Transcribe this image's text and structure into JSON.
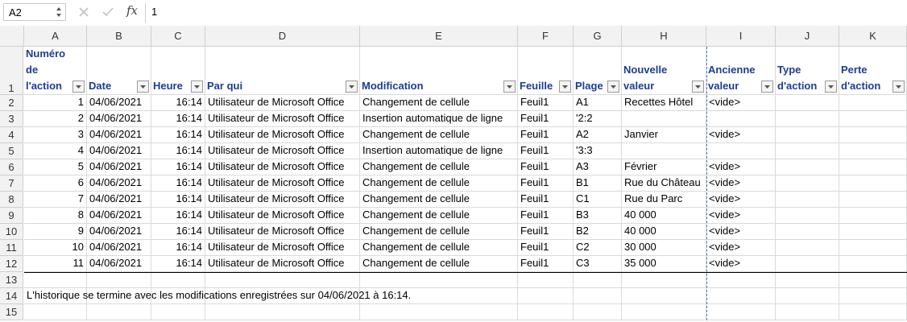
{
  "formula_bar": {
    "name_box": "A2",
    "formula": "1",
    "icons": [
      "cancel-icon",
      "confirm-icon",
      "fx-icon"
    ]
  },
  "columns": [
    "A",
    "B",
    "C",
    "D",
    "E",
    "F",
    "G",
    "H",
    "I",
    "J",
    "K"
  ],
  "row_numbers": [
    "1",
    "2",
    "3",
    "4",
    "5",
    "6",
    "7",
    "8",
    "9",
    "10",
    "11",
    "12",
    "13",
    "14",
    "15"
  ],
  "headers": {
    "A": "Numéro de l'action",
    "B": "Date",
    "C": "Heure",
    "D": "Par qui",
    "E": "Modification",
    "F": "Feuille",
    "G": "Plage",
    "H": "Nouvelle valeur",
    "I": "Ancienne valeur",
    "J": "Type d'action",
    "K": "Perte d'action"
  },
  "rows": [
    {
      "num": "1",
      "date": "04/06/2021",
      "time": "16:14",
      "who": "Utilisateur de Microsoft Office",
      "mod": "Changement de cellule",
      "sheet": "Feuil1",
      "range": "A1",
      "new": "Recettes Hôtel",
      "old": "<vide>"
    },
    {
      "num": "2",
      "date": "04/06/2021",
      "time": "16:14",
      "who": "Utilisateur de Microsoft Office",
      "mod": "Insertion automatique de ligne",
      "sheet": "Feuil1",
      "range": "'2:2",
      "new": "",
      "old": ""
    },
    {
      "num": "3",
      "date": "04/06/2021",
      "time": "16:14",
      "who": "Utilisateur de Microsoft Office",
      "mod": "Changement de cellule",
      "sheet": "Feuil1",
      "range": "A2",
      "new": "Janvier",
      "old": "<vide>"
    },
    {
      "num": "4",
      "date": "04/06/2021",
      "time": "16:14",
      "who": "Utilisateur de Microsoft Office",
      "mod": "Insertion automatique de ligne",
      "sheet": "Feuil1",
      "range": "'3:3",
      "new": "",
      "old": ""
    },
    {
      "num": "5",
      "date": "04/06/2021",
      "time": "16:14",
      "who": "Utilisateur de Microsoft Office",
      "mod": "Changement de cellule",
      "sheet": "Feuil1",
      "range": "A3",
      "new": "Février",
      "old": "<vide>"
    },
    {
      "num": "6",
      "date": "04/06/2021",
      "time": "16:14",
      "who": "Utilisateur de Microsoft Office",
      "mod": "Changement de cellule",
      "sheet": "Feuil1",
      "range": "B1",
      "new": "Rue du Château",
      "old": "<vide>"
    },
    {
      "num": "7",
      "date": "04/06/2021",
      "time": "16:14",
      "who": "Utilisateur de Microsoft Office",
      "mod": "Changement de cellule",
      "sheet": "Feuil1",
      "range": "C1",
      "new": "Rue du Parc",
      "old": "<vide>"
    },
    {
      "num": "8",
      "date": "04/06/2021",
      "time": "16:14",
      "who": "Utilisateur de Microsoft Office",
      "mod": "Changement de cellule",
      "sheet": "Feuil1",
      "range": "B3",
      "new": "40 000",
      "old": "<vide>"
    },
    {
      "num": "9",
      "date": "04/06/2021",
      "time": "16:14",
      "who": "Utilisateur de Microsoft Office",
      "mod": "Changement de cellule",
      "sheet": "Feuil1",
      "range": "B2",
      "new": "40 000",
      "old": "<vide>"
    },
    {
      "num": "10",
      "date": "04/06/2021",
      "time": "16:14",
      "who": "Utilisateur de Microsoft Office",
      "mod": "Changement de cellule",
      "sheet": "Feuil1",
      "range": "C2",
      "new": "30 000",
      "old": "<vide>"
    },
    {
      "num": "11",
      "date": "04/06/2021",
      "time": "16:14",
      "who": "Utilisateur de Microsoft Office",
      "mod": "Changement de cellule",
      "sheet": "Feuil1",
      "range": "C3",
      "new": "35 000",
      "old": "<vide>"
    }
  ],
  "footer_note": "L'historique se termine avec les modifications enregistrées sur 04/06/2021 à 16:14.",
  "colors": {
    "header_text": "#1f3c8f",
    "page_break": "#4a7cc7"
  }
}
